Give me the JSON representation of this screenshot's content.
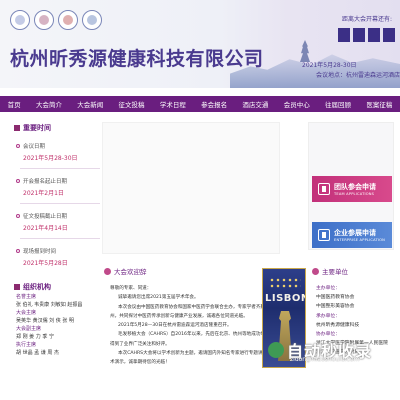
{
  "header": {
    "logos": [
      "logo-1",
      "logo-2",
      "logo-3",
      "logo-4"
    ],
    "title": "杭州昕秀源健康科技有限公司",
    "countdown_label": "距离大会开幕还有:",
    "countdown_digits": [
      "",
      "",
      "",
      ""
    ],
    "dates_line": "2021年5月28-30日",
    "venue_line": "会议地点：杭州雷迪森运河酒店"
  },
  "nav": {
    "items": [
      "首页",
      "大会简介",
      "大会新闻",
      "征文投稿",
      "学术日程",
      "参会报名",
      "酒店交通",
      "会员中心",
      "往届回顾",
      "医案征稿"
    ]
  },
  "sidebar": {
    "dates_title": "重要时间",
    "dates": [
      {
        "label": "会议日期",
        "value": "2021年5月28-30日"
      },
      {
        "label": "开会报名起止日期",
        "value": "2021年2月1日"
      },
      {
        "label": "征文投稿截止日期",
        "value": "2021年4月14日"
      },
      {
        "label": "现场报到时间",
        "value": "2021年5月28日"
      }
    ],
    "org_title": "组织机构",
    "org_lines": [
      {
        "text": "名誉主席",
        "role": true
      },
      {
        "text": "张 伯礼  韦贵康  刘敏如  赵振昌",
        "role": false
      },
      {
        "text": "大会主席",
        "role": true
      },
      {
        "text": "吴英华  黄汉儒  刘 侠  张 明",
        "role": false
      },
      {
        "text": "大会副主席",
        "role": true
      },
      {
        "text": "郑 刚  姜 力  季 宁",
        "role": false
      },
      {
        "text": "执行主席",
        "role": true
      },
      {
        "text": "胡 世晶  孟 谦  周 杰",
        "role": false
      }
    ]
  },
  "welcome": {
    "title": "大会欢迎辞",
    "salutation": "尊敬的专家、同道：",
    "paragraphs": [
      "诚挚邀请您出席2021第五届学术年会。",
      "本次会议由中国医药教育协会和国家中医药学会联合主办，专家学者齐聚杭州，共同探讨中医药传承创新与健康产业发展，诚邀各位同道光临。",
      "2021年5月28—30日在杭州雷迪森运河酒店隆重召开。",
      "毛发移植大会（CAHRS）自2016年以来，先后在北京、杭州等地成功举办，得到了业界广泛关注和好评。",
      "本次CAHRS大会将以学术创新为主题，邀请国内外知名专家进行专题讲座与手术演示，诚挚期待您的光临！"
    ]
  },
  "poster": {
    "text": "LISBON"
  },
  "right": {
    "team_apply": {
      "label": "团队参会申请",
      "sub": "TEAM APPLICATIONS"
    },
    "enterprise_apply": {
      "label": "企业参展申请",
      "sub": "ENTERPRISE APPLICATION"
    },
    "host_title": "主要单位",
    "host_lines": [
      {
        "text": "主办单位：",
        "role": true
      },
      {
        "text": "中国医药教育协会",
        "role": false
      },
      {
        "text": "中国整形美容协会",
        "role": false
      },
      {
        "text": "承办单位：",
        "role": true
      },
      {
        "text": "杭州昕秀源健康科技",
        "role": false
      },
      {
        "text": "协办单位：",
        "role": true
      },
      {
        "text": "浙江大学医学院附属第一人民医院",
        "role": false
      },
      {
        "text": "浙江大学医学院附属",
        "role": false
      }
    ]
  },
  "watermark": {
    "text": "自动秒收录",
    "sub": "zidongmiaoshoulu.com"
  },
  "colors": {
    "brand_purple": "#6a1e7f",
    "accent_pink": "#c0306a",
    "team_btn": "#c2307a",
    "enterprise_btn": "#3d6fc8"
  }
}
